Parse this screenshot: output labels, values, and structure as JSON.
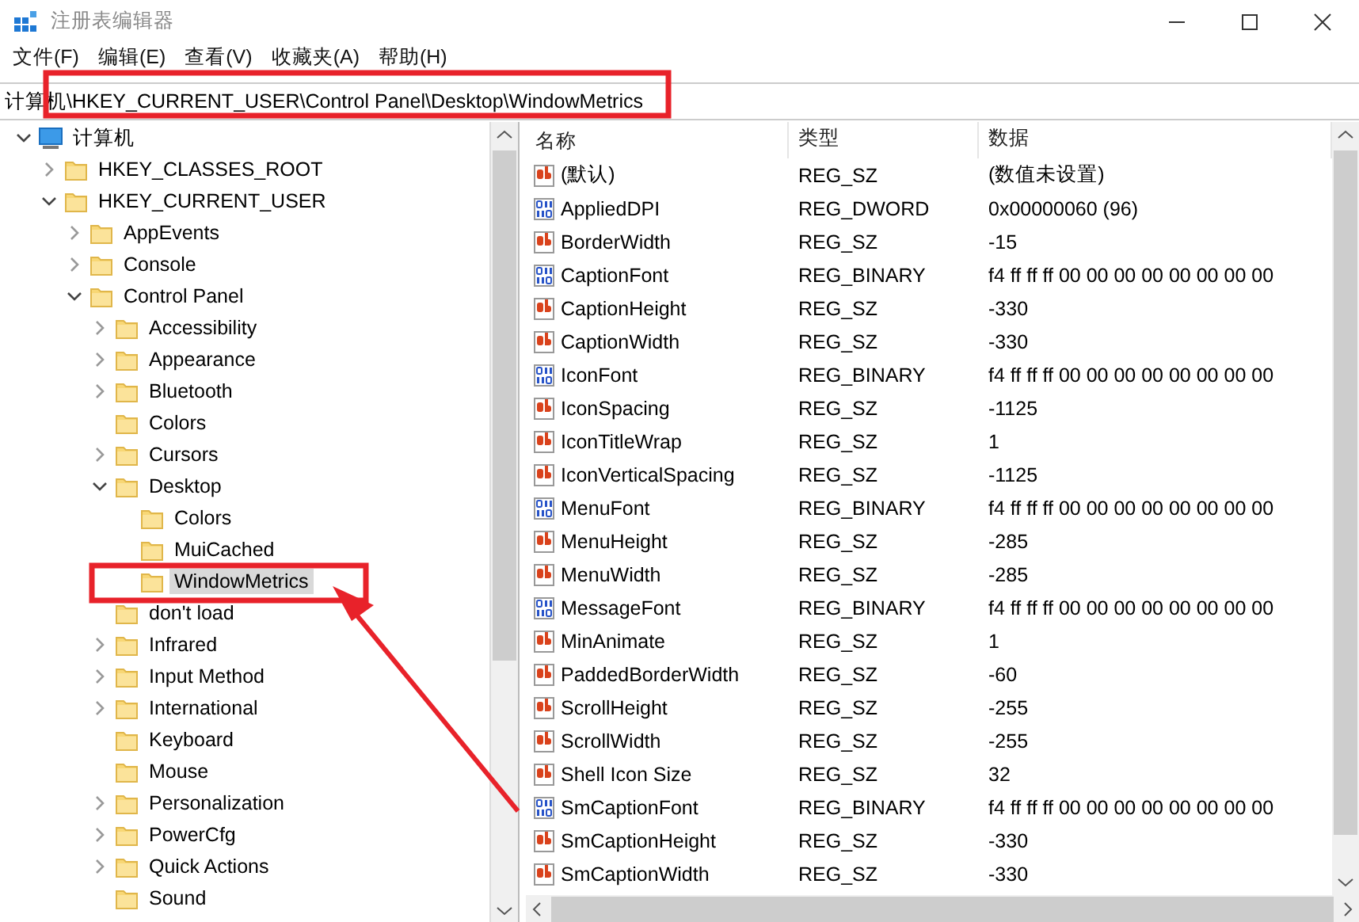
{
  "window": {
    "title": "注册表编辑器"
  },
  "menu": [
    "文件(F)",
    "编辑(E)",
    "查看(V)",
    "收藏夹(A)",
    "帮助(H)"
  ],
  "address": "计算机\\HKEY_CURRENT_USER\\Control Panel\\Desktop\\WindowMetrics",
  "tree": {
    "label": "计算机",
    "expandable": true,
    "expanded": true,
    "selected": false,
    "children": [
      {
        "label": "HKEY_CLASSES_ROOT",
        "expandable": true,
        "expanded": false,
        "selected": false
      },
      {
        "label": "HKEY_CURRENT_USER",
        "expandable": true,
        "expanded": true,
        "selected": false,
        "children": [
          {
            "label": "AppEvents",
            "expandable": true,
            "expanded": false,
            "selected": false
          },
          {
            "label": "Console",
            "expandable": true,
            "expanded": false,
            "selected": false
          },
          {
            "label": "Control Panel",
            "expandable": true,
            "expanded": true,
            "selected": false,
            "children": [
              {
                "label": "Accessibility",
                "expandable": true,
                "expanded": false,
                "selected": false
              },
              {
                "label": "Appearance",
                "expandable": true,
                "expanded": false,
                "selected": false
              },
              {
                "label": "Bluetooth",
                "expandable": true,
                "expanded": false,
                "selected": false
              },
              {
                "label": "Colors",
                "expandable": false,
                "selected": false
              },
              {
                "label": "Cursors",
                "expandable": true,
                "expanded": false,
                "selected": false
              },
              {
                "label": "Desktop",
                "expandable": true,
                "expanded": true,
                "selected": false,
                "children": [
                  {
                    "label": "Colors",
                    "expandable": false,
                    "selected": false
                  },
                  {
                    "label": "MuiCached",
                    "expandable": false,
                    "selected": false
                  },
                  {
                    "label": "WindowMetrics",
                    "expandable": false,
                    "selected": true
                  }
                ]
              },
              {
                "label": "don't load",
                "expandable": false,
                "selected": false
              },
              {
                "label": "Infrared",
                "expandable": true,
                "expanded": false,
                "selected": false
              },
              {
                "label": "Input Method",
                "expandable": true,
                "expanded": false,
                "selected": false
              },
              {
                "label": "International",
                "expandable": true,
                "expanded": false,
                "selected": false
              },
              {
                "label": "Keyboard",
                "expandable": false,
                "selected": false
              },
              {
                "label": "Mouse",
                "expandable": false,
                "selected": false
              },
              {
                "label": "Personalization",
                "expandable": true,
                "expanded": false,
                "selected": false
              },
              {
                "label": "PowerCfg",
                "expandable": true,
                "expanded": false,
                "selected": false
              },
              {
                "label": "Quick Actions",
                "expandable": true,
                "expanded": false,
                "selected": false
              },
              {
                "label": "Sound",
                "expandable": false,
                "selected": false
              }
            ]
          }
        ]
      }
    ]
  },
  "list": {
    "columns": [
      "名称",
      "类型",
      "数据"
    ],
    "rows": [
      {
        "kind": "string",
        "name": "(默认)",
        "type": "REG_SZ",
        "data": "(数值未设置)"
      },
      {
        "kind": "binary",
        "name": "AppliedDPI",
        "type": "REG_DWORD",
        "data": "0x00000060 (96)"
      },
      {
        "kind": "string",
        "name": "BorderWidth",
        "type": "REG_SZ",
        "data": "-15"
      },
      {
        "kind": "binary",
        "name": "CaptionFont",
        "type": "REG_BINARY",
        "data": "f4 ff ff ff 00 00 00 00 00 00 00 00"
      },
      {
        "kind": "string",
        "name": "CaptionHeight",
        "type": "REG_SZ",
        "data": "-330"
      },
      {
        "kind": "string",
        "name": "CaptionWidth",
        "type": "REG_SZ",
        "data": "-330"
      },
      {
        "kind": "binary",
        "name": "IconFont",
        "type": "REG_BINARY",
        "data": "f4 ff ff ff 00 00 00 00 00 00 00 00"
      },
      {
        "kind": "string",
        "name": "IconSpacing",
        "type": "REG_SZ",
        "data": "-1125"
      },
      {
        "kind": "string",
        "name": "IconTitleWrap",
        "type": "REG_SZ",
        "data": "1"
      },
      {
        "kind": "string",
        "name": "IconVerticalSpacing",
        "type": "REG_SZ",
        "data": "-1125"
      },
      {
        "kind": "binary",
        "name": "MenuFont",
        "type": "REG_BINARY",
        "data": "f4 ff ff ff 00 00 00 00 00 00 00 00"
      },
      {
        "kind": "string",
        "name": "MenuHeight",
        "type": "REG_SZ",
        "data": "-285"
      },
      {
        "kind": "string",
        "name": "MenuWidth",
        "type": "REG_SZ",
        "data": "-285"
      },
      {
        "kind": "binary",
        "name": "MessageFont",
        "type": "REG_BINARY",
        "data": "f4 ff ff ff 00 00 00 00 00 00 00 00"
      },
      {
        "kind": "string",
        "name": "MinAnimate",
        "type": "REG_SZ",
        "data": "1"
      },
      {
        "kind": "string",
        "name": "PaddedBorderWidth",
        "type": "REG_SZ",
        "data": "-60"
      },
      {
        "kind": "string",
        "name": "ScrollHeight",
        "type": "REG_SZ",
        "data": "-255"
      },
      {
        "kind": "string",
        "name": "ScrollWidth",
        "type": "REG_SZ",
        "data": "-255"
      },
      {
        "kind": "string",
        "name": "Shell Icon Size",
        "type": "REG_SZ",
        "data": "32"
      },
      {
        "kind": "binary",
        "name": "SmCaptionFont",
        "type": "REG_BINARY",
        "data": "f4 ff ff ff 00 00 00 00 00 00 00 00"
      },
      {
        "kind": "string",
        "name": "SmCaptionHeight",
        "type": "REG_SZ",
        "data": "-330"
      },
      {
        "kind": "string",
        "name": "SmCaptionWidth",
        "type": "REG_SZ",
        "data": "-330"
      }
    ]
  },
  "annotations": [
    {
      "kind": "box"
    },
    {
      "kind": "box"
    },
    {
      "kind": "arrow"
    }
  ]
}
